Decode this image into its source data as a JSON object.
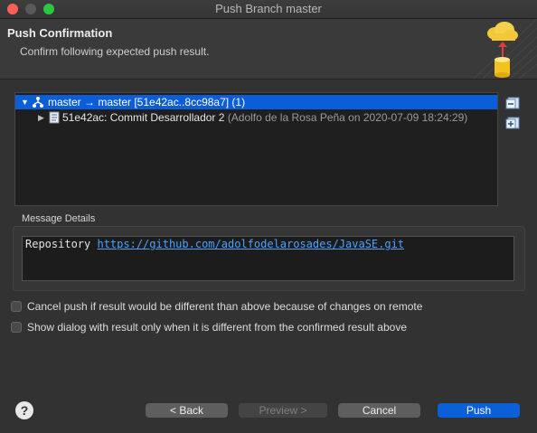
{
  "window": {
    "title": "Push Branch master"
  },
  "header": {
    "title": "Push Confirmation",
    "subtitle": "Confirm following expected push result."
  },
  "tree": {
    "rows": [
      {
        "label": "master → master [51e42ac..8cc98a7] (1)",
        "expanded": true,
        "selected": true
      },
      {
        "label": "51e42ac: Commit Desarrollador 2",
        "meta": "(Adolfo de la Rosa Peña on 2020-07-09 18:24:29)",
        "expanded": false
      }
    ]
  },
  "message_details": {
    "label": "Message Details",
    "prefix": "Repository",
    "url": "https://github.com/adolfodelarosades/JavaSE.git"
  },
  "options": [
    {
      "label": "Cancel push if result would be different than above because of changes on remote",
      "checked": false
    },
    {
      "label": "Show dialog with result only when it is different from the confirmed result above",
      "checked": false
    }
  ],
  "buttons": {
    "back": "< Back",
    "preview": "Preview >",
    "cancel": "Cancel",
    "push": "Push"
  },
  "colors": {
    "accent": "#0a60d8",
    "link": "#4ea1ff",
    "background": "#323232"
  }
}
